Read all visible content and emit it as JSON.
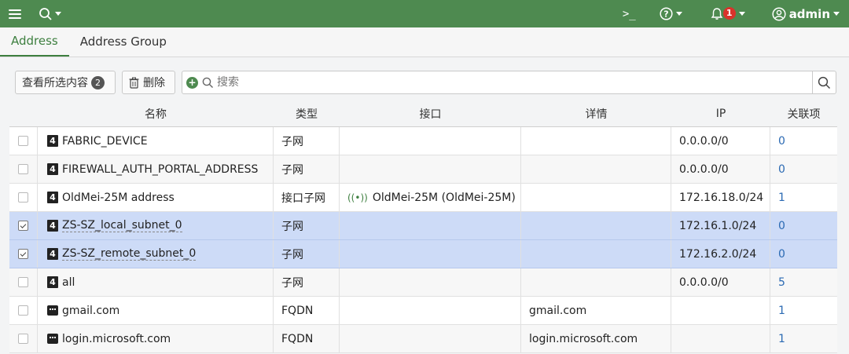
{
  "topbar": {
    "terminal_glyph": ">_",
    "help_glyph": "?",
    "notifications_count": "1",
    "user": "admin",
    "colors": {
      "bg": "#4e8a50",
      "badge": "#d9332b"
    }
  },
  "tabs": [
    {
      "label": "Address",
      "active": true
    },
    {
      "label": "Address Group",
      "active": false
    }
  ],
  "toolbar": {
    "view_selected_label": "查看所选内容",
    "selected_count": "2",
    "delete_label": "删除",
    "search_placeholder": "搜索"
  },
  "columns": [
    "名称",
    "类型",
    "接口",
    "详情",
    "IP",
    "关联项"
  ],
  "rows": [
    {
      "checked": false,
      "icon": "address-icon",
      "name": "FABRIC_DEVICE",
      "type": "子网",
      "interface": "",
      "details": "",
      "ip": "0.0.0.0/0",
      "refs": "0"
    },
    {
      "checked": false,
      "icon": "address-icon",
      "name": "FIREWALL_AUTH_PORTAL_ADDRESS",
      "type": "子网",
      "interface": "",
      "details": "",
      "ip": "0.0.0.0/0",
      "refs": "0"
    },
    {
      "checked": false,
      "icon": "address-icon",
      "name": "OldMei-25M address",
      "type": "接口子网",
      "interface": "OldMei-25M (OldMei-25M)",
      "details": "",
      "ip": "172.16.18.0/24",
      "refs": "1"
    },
    {
      "checked": true,
      "icon": "address-icon",
      "name": "ZS-SZ_local_subnet_0",
      "type": "子网",
      "interface": "",
      "details": "",
      "ip": "172.16.1.0/24",
      "refs": "0"
    },
    {
      "checked": true,
      "icon": "address-icon",
      "name": "ZS-SZ_remote_subnet_0",
      "type": "子网",
      "interface": "",
      "details": "",
      "ip": "172.16.2.0/24",
      "refs": "0"
    },
    {
      "checked": false,
      "icon": "address-icon",
      "name": "all",
      "type": "子网",
      "interface": "",
      "details": "",
      "ip": "0.0.0.0/0",
      "refs": "5"
    },
    {
      "checked": false,
      "icon": "fqdn-icon",
      "name": "gmail.com",
      "type": "FQDN",
      "interface": "",
      "details": "gmail.com",
      "ip": "",
      "refs": "1"
    },
    {
      "checked": false,
      "icon": "fqdn-icon",
      "name": "login.microsoft.com",
      "type": "FQDN",
      "interface": "",
      "details": "login.microsoft.com",
      "ip": "",
      "refs": "1"
    }
  ]
}
